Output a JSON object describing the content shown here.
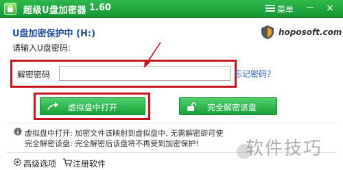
{
  "titlebar": {
    "title": "超级U盘加密器",
    "version": "1.60",
    "menu_label": "菜单",
    "minimize": "－",
    "close": "×"
  },
  "main": {
    "heading": "U盘加密保护中 (H:)",
    "logo_text": "hoposoft.com",
    "prompt": "请输入U盘密码:",
    "password_label": "解密密码",
    "password_value": "",
    "forgot_link": "忘记密码？"
  },
  "buttons": {
    "open_virtual": "虚拟盘中打开",
    "full_unlock": "完全解密该盘"
  },
  "info": {
    "line1": "虚拟盘中打开: 加密文件该映射到虚拟盘中, 无需解密即可使",
    "line2": "完全解密该盘: 完全解密后该盘将不再受到加密保护!"
  },
  "footer": {
    "advanced": "高级选项",
    "register": "注册软件"
  },
  "watermark": "软件技巧",
  "colors": {
    "titlebar": "#139632",
    "button": "#18a23a",
    "highlight": "#c9131c",
    "heading": "#1f4e9a"
  }
}
